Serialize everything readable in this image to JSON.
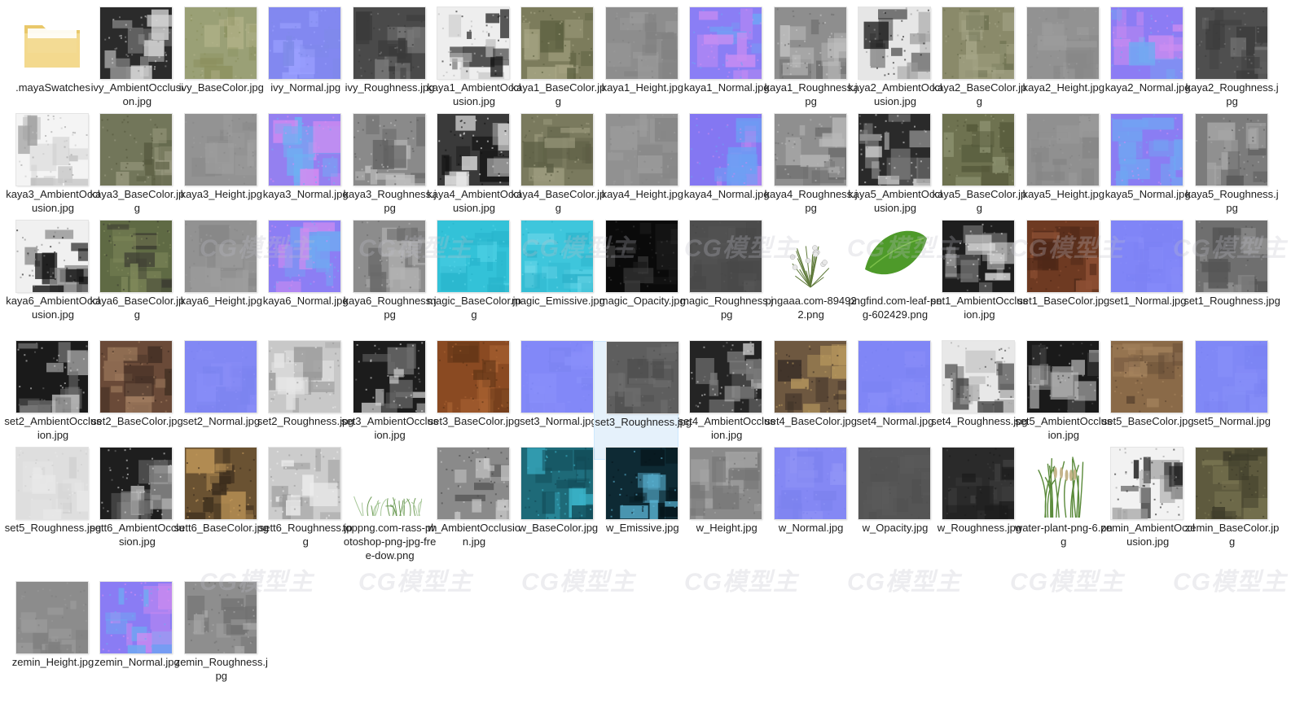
{
  "watermark_text": "CG模型主",
  "files": [
    {
      "name": ".mayaSwatches",
      "kind": "folder",
      "colors": [
        "#f2d98e",
        "#e9c86a"
      ]
    },
    {
      "name": "ivy_AmbientOcclusion.jpg",
      "kind": "map",
      "colors": [
        "#2b2b2b",
        "#d8d8d8",
        "#8a8a8a"
      ]
    },
    {
      "name": "ivy_BaseColor.jpg",
      "kind": "map",
      "colors": [
        "#9aa076",
        "#8c915f",
        "#b3b38a"
      ]
    },
    {
      "name": "ivy_Normal.jpg",
      "kind": "map",
      "colors": [
        "#8288f0",
        "#9aa0ff",
        "#7e8ae8"
      ]
    },
    {
      "name": "ivy_Roughness.jpg",
      "kind": "map",
      "colors": [
        "#4a4a4a",
        "#7a7a7a",
        "#3a3a3a"
      ]
    },
    {
      "name": "kaya1_AmbientOcclusion.jpg",
      "kind": "map",
      "colors": [
        "#eeeeee",
        "#1a1a1a",
        "#bbbbbb"
      ]
    },
    {
      "name": "kaya1_BaseColor.jpg",
      "kind": "map",
      "colors": [
        "#7c7c5c",
        "#a8a685",
        "#5d6141"
      ]
    },
    {
      "name": "kaya1_Height.jpg",
      "kind": "map",
      "colors": [
        "#8d8d8d",
        "#999999",
        "#828282"
      ]
    },
    {
      "name": "kaya1_Normal.jpg",
      "kind": "map",
      "colors": [
        "#8a7ef5",
        "#c98cf2",
        "#6fa4f5"
      ]
    },
    {
      "name": "kaya1_Roughness.jpg",
      "kind": "map",
      "colors": [
        "#8e8e8e",
        "#6a6a6a",
        "#c4c4c4"
      ]
    },
    {
      "name": "kaya2_AmbientOcclusion.jpg",
      "kind": "map",
      "colors": [
        "#e6e6e6",
        "#1c1c1c",
        "#9a9a9a"
      ]
    },
    {
      "name": "kaya2_BaseColor.jpg",
      "kind": "map",
      "colors": [
        "#8a8a6a",
        "#a4a486",
        "#6e7252"
      ]
    },
    {
      "name": "kaya2_Height.jpg",
      "kind": "map",
      "colors": [
        "#929292",
        "#9c9c9c",
        "#888888"
      ]
    },
    {
      "name": "kaya2_Normal.jpg",
      "kind": "map",
      "colors": [
        "#8c7cf4",
        "#cf8df0",
        "#73a8f2"
      ]
    },
    {
      "name": "kaya2_Roughness.jpg",
      "kind": "map",
      "colors": [
        "#4f4f4f",
        "#747474",
        "#3c3c3c"
      ]
    },
    {
      "name": "kaya3_AmbientOcclusion.jpg",
      "kind": "map",
      "colors": [
        "#f4f4f4",
        "#c8c8c8",
        "#9e9e9e"
      ]
    },
    {
      "name": "kaya3_BaseColor.jpg",
      "kind": "map",
      "colors": [
        "#72765a",
        "#9a9a80",
        "#56593e"
      ]
    },
    {
      "name": "kaya3_Height.jpg",
      "kind": "map",
      "colors": [
        "#939393",
        "#9e9e9e",
        "#878787"
      ]
    },
    {
      "name": "kaya3_Normal.jpg",
      "kind": "map",
      "colors": [
        "#9480f0",
        "#d88bf0",
        "#6eb0f3"
      ]
    },
    {
      "name": "kaya3_Roughness.jpg",
      "kind": "map",
      "colors": [
        "#8a8a8a",
        "#5e5e5e",
        "#c0c0c0"
      ]
    },
    {
      "name": "kaya4_AmbientOcclusion.jpg",
      "kind": "map",
      "colors": [
        "#3a3a3a",
        "#e8e8e8",
        "#111111"
      ]
    },
    {
      "name": "kaya4_BaseColor.jpg",
      "kind": "map",
      "colors": [
        "#7a7a5e",
        "#9e9d80",
        "#5c5e44"
      ]
    },
    {
      "name": "kaya4_Height.jpg",
      "kind": "map",
      "colors": [
        "#919191",
        "#9b9b9b",
        "#868686"
      ]
    },
    {
      "name": "kaya4_Normal.jpg",
      "kind": "map",
      "colors": [
        "#8477f2",
        "#c489ef",
        "#6d9ff4"
      ]
    },
    {
      "name": "kaya4_Roughness.jpg",
      "kind": "map",
      "colors": [
        "#8f8f8f",
        "#b8b8b8",
        "#6c6c6c"
      ]
    },
    {
      "name": "kaya5_AmbientOcclusion.jpg",
      "kind": "map",
      "colors": [
        "#2a2a2a",
        "#dcdcdc",
        "#8e8e8e"
      ]
    },
    {
      "name": "kaya5_BaseColor.jpg",
      "kind": "map",
      "colors": [
        "#6e7250",
        "#8f9472",
        "#55593a"
      ]
    },
    {
      "name": "kaya5_Height.jpg",
      "kind": "map",
      "colors": [
        "#909090",
        "#9a9a9a",
        "#858585"
      ]
    },
    {
      "name": "kaya5_Normal.jpg",
      "kind": "map",
      "colors": [
        "#8a7df3",
        "#cc8cf0",
        "#70a6f2"
      ]
    },
    {
      "name": "kaya5_Roughness.jpg",
      "kind": "map",
      "colors": [
        "#7c7c7c",
        "#a6a6a6",
        "#5a5a5a"
      ]
    },
    {
      "name": "kaya6_AmbientOcclusion.jpg",
      "kind": "map",
      "colors": [
        "#f0f0f0",
        "#111111",
        "#8a8a8a"
      ]
    },
    {
      "name": "kaya6_BaseColor.jpg",
      "kind": "map",
      "colors": [
        "#5f6a44",
        "#3c3c32",
        "#7f885a"
      ]
    },
    {
      "name": "kaya6_Height.jpg",
      "kind": "map",
      "colors": [
        "#929292",
        "#9d9d9d",
        "#878787"
      ]
    },
    {
      "name": "kaya6_Normal.jpg",
      "kind": "map",
      "colors": [
        "#8c7ef4",
        "#d08cf0",
        "#70aaf2"
      ]
    },
    {
      "name": "kaya6_Roughness.jpg",
      "kind": "map",
      "colors": [
        "#8c8c8c",
        "#6a6a6a",
        "#b4b4b4"
      ]
    },
    {
      "name": "magic_BaseColor.jpg",
      "kind": "map",
      "colors": [
        "#33c2d8",
        "#52d2e6",
        "#28b4cc"
      ]
    },
    {
      "name": "magic_Emissive.jpg",
      "kind": "map",
      "colors": [
        "#3ec6dc",
        "#6ad6e8",
        "#2cb2ca"
      ]
    },
    {
      "name": "magic_Opacity.jpg",
      "kind": "map",
      "colors": [
        "#0a0a0a",
        "#3a3a3a",
        "#1a1a1a"
      ]
    },
    {
      "name": "magic_Roughness.jpg",
      "kind": "map",
      "colors": [
        "#4e4e4e",
        "#565656",
        "#484848"
      ]
    },
    {
      "name": "pngaaa.com-894922.png",
      "kind": "plant",
      "colors": [
        "#ffffff",
        "#5f7a3a",
        "#e8e8e8"
      ]
    },
    {
      "name": "pngfind.com-leaf-png-602429.png",
      "kind": "leaf",
      "colors": [
        "#ffffff",
        "#4e9a2a",
        "#7cc04a"
      ]
    },
    {
      "name": "set1_AmbientOcclusion.jpg",
      "kind": "map",
      "colors": [
        "#1e1e1e",
        "#dedede",
        "#777777"
      ]
    },
    {
      "name": "set1_BaseColor.jpg",
      "kind": "map",
      "colors": [
        "#6e3a22",
        "#8e5034",
        "#4e2818"
      ]
    },
    {
      "name": "set1_Normal.jpg",
      "kind": "map",
      "colors": [
        "#8085f7",
        "#878cf9",
        "#7c82f4"
      ]
    },
    {
      "name": "set1_Roughness.jpg",
      "kind": "map",
      "colors": [
        "#6f6f6f",
        "#8e8e8e",
        "#555555"
      ]
    },
    {
      "name": "set2_AmbientOcclusion.jpg",
      "kind": "map",
      "colors": [
        "#1a1a1a",
        "#cfcfcf",
        "#6a6a6a"
      ]
    },
    {
      "name": "set2_BaseColor.jpg",
      "kind": "map",
      "colors": [
        "#6a4a38",
        "#a07c5e",
        "#3e2c22"
      ]
    },
    {
      "name": "set2_Normal.jpg",
      "kind": "map",
      "colors": [
        "#8288f4",
        "#8a8ef8",
        "#7c84f0"
      ]
    },
    {
      "name": "set2_Roughness.jpg",
      "kind": "map",
      "colors": [
        "#c8c8c8",
        "#e6e6e6",
        "#9a9a9a"
      ]
    },
    {
      "name": "set3_AmbientOcclusion.jpg",
      "kind": "map",
      "colors": [
        "#1c1c1c",
        "#d8d8d8",
        "#6e6e6e"
      ]
    },
    {
      "name": "set3_BaseColor.jpg",
      "kind": "map",
      "colors": [
        "#8a4a22",
        "#a86232",
        "#5e3416"
      ]
    },
    {
      "name": "set3_Normal.jpg",
      "kind": "map",
      "colors": [
        "#8288f8",
        "#898ffa",
        "#7c84f2"
      ]
    },
    {
      "name": "set3_Roughness.jpg",
      "kind": "map",
      "colors": [
        "#5e5e5e",
        "#6e6e6e",
        "#4e4e4e"
      ],
      "selected": true
    },
    {
      "name": "set4_AmbientOcclusion.jpg",
      "kind": "map",
      "colors": [
        "#242424",
        "#d0d0d0",
        "#7a7a7a"
      ]
    },
    {
      "name": "set4_BaseColor.jpg",
      "kind": "map",
      "colors": [
        "#6e5840",
        "#b8985e",
        "#3a2e26"
      ]
    },
    {
      "name": "set4_Normal.jpg",
      "kind": "map",
      "colors": [
        "#8086f6",
        "#888df8",
        "#7a82f2"
      ]
    },
    {
      "name": "set4_Roughness.jpg",
      "kind": "map",
      "colors": [
        "#e8e8e8",
        "#3a3a3a",
        "#a8a8a8"
      ]
    },
    {
      "name": "set5_AmbientOcclusion.jpg",
      "kind": "map",
      "colors": [
        "#1a1a1a",
        "#bdbdbd",
        "#4a4a4a"
      ]
    },
    {
      "name": "set5_BaseColor.jpg",
      "kind": "map",
      "colors": [
        "#8a6a48",
        "#a6845e",
        "#5e4632"
      ]
    },
    {
      "name": "set5_Normal.jpg",
      "kind": "map",
      "colors": [
        "#8088f6",
        "#868ef8",
        "#7a82f2"
      ]
    },
    {
      "name": "set5_Roughness.jpg",
      "kind": "map",
      "colors": [
        "#dedede",
        "#e8e8e8",
        "#cfcfcf"
      ]
    },
    {
      "name": "sett6_AmbientOcclusion.jpg",
      "kind": "map",
      "colors": [
        "#1e1e1e",
        "#d4d4d4",
        "#6c6c6c"
      ]
    },
    {
      "name": "sett6_BaseColor.jpg",
      "kind": "map",
      "colors": [
        "#6a5232",
        "#c49a5a",
        "#3a2c1c"
      ]
    },
    {
      "name": "sett6_Roughness.jpg",
      "kind": "map",
      "colors": [
        "#cccccc",
        "#ececec",
        "#9a9a9a"
      ]
    },
    {
      "name": "toppng.com-rass-photoshop-png-jpg-free-dow.png",
      "kind": "grass",
      "colors": [
        "#ffffff",
        "#6c9a54",
        "#a8c89a"
      ]
    },
    {
      "name": "w_AmbientOcclusion.jpg",
      "kind": "map",
      "colors": [
        "#8a8a8a",
        "#c8c8c8",
        "#4a4a4a"
      ]
    },
    {
      "name": "w_BaseColor.jpg",
      "kind": "map",
      "colors": [
        "#1e6a78",
        "#3ab2c8",
        "#124a56"
      ]
    },
    {
      "name": "w_Emissive.jpg",
      "kind": "map",
      "colors": [
        "#0e2a34",
        "#5ab4d4",
        "#06161c"
      ]
    },
    {
      "name": "w_Height.jpg",
      "kind": "map",
      "colors": [
        "#8a8a8a",
        "#a4a4a4",
        "#727272"
      ]
    },
    {
      "name": "w_Normal.jpg",
      "kind": "map",
      "colors": [
        "#8488f4",
        "#9094f6",
        "#7c82ee"
      ]
    },
    {
      "name": "w_Opacity.jpg",
      "kind": "map",
      "colors": [
        "#555555",
        "#5a5a5a",
        "#505050"
      ]
    },
    {
      "name": "w_Roughness.jpg",
      "kind": "map",
      "colors": [
        "#2a2a2a",
        "#3e3e3e",
        "#1c1c1c"
      ]
    },
    {
      "name": "water-plant-png-6.png",
      "kind": "reeds",
      "colors": [
        "#ffffff",
        "#5a8a3a",
        "#c4b48a"
      ]
    },
    {
      "name": "zemin_AmbientOcclusion.jpg",
      "kind": "map",
      "colors": [
        "#f2f2f2",
        "#1e1e1e",
        "#9c9c9c"
      ]
    },
    {
      "name": "zemin_BaseColor.jpg",
      "kind": "map",
      "colors": [
        "#5e5a3e",
        "#7a7652",
        "#3e3c2a"
      ]
    },
    {
      "name": "zemin_Height.jpg",
      "kind": "map",
      "colors": [
        "#8c8c8c",
        "#9a9a9a",
        "#7e7e7e"
      ]
    },
    {
      "name": "zemin_Normal.jpg",
      "kind": "map",
      "colors": [
        "#8a7cf4",
        "#d28cf0",
        "#6eaaf2"
      ]
    },
    {
      "name": "zemin_Roughness.jpg",
      "kind": "map",
      "colors": [
        "#8e8e8e",
        "#a8a8a8",
        "#727272"
      ]
    }
  ]
}
